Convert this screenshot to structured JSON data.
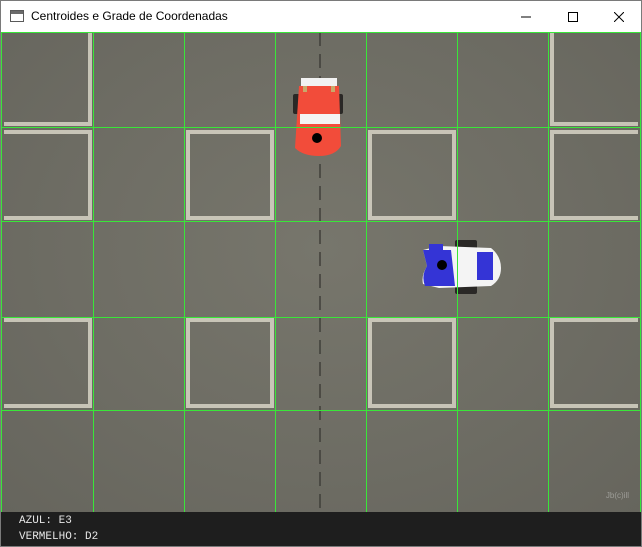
{
  "window": {
    "title": "Centroides e Grade de Coordenadas",
    "controls": [
      "minimize",
      "maximize",
      "close"
    ]
  },
  "view": {
    "grid_color": "#39e639",
    "grid_columns": 7,
    "grid_rows": 5,
    "objects": [
      {
        "name": "red-car",
        "color": "#ff5040",
        "grid_cell": "D2"
      },
      {
        "name": "blue-car",
        "color": "#2b2bd8",
        "grid_cell": "E3"
      }
    ],
    "watermark": "Jb(c)ill"
  },
  "status": {
    "blue_line": "AZUL: E3",
    "red_line": "VERMELHO: D2"
  }
}
